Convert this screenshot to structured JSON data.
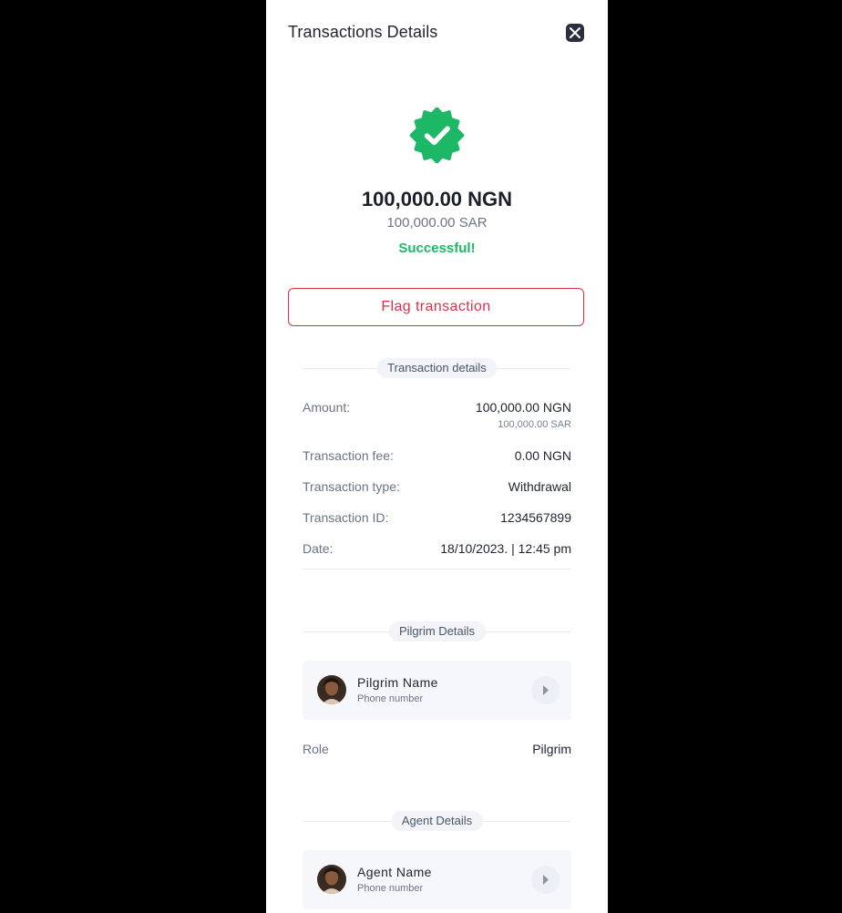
{
  "header": {
    "title": "Transactions Details"
  },
  "summary": {
    "amount": "100,000.00 NGN",
    "amount_alt": "100,000.00 SAR",
    "status": "Successful!"
  },
  "actions": {
    "flag_label": "Flag transaction"
  },
  "transaction_details": {
    "heading": "Transaction details",
    "rows": [
      {
        "label": "Amount:",
        "value": "100,000.00 NGN",
        "subvalue": "100,000.00 SAR"
      },
      {
        "label": "Transaction fee:",
        "value": "0.00 NGN"
      },
      {
        "label": "Transaction type:",
        "value": "Withdrawal"
      },
      {
        "label": "Transaction ID:",
        "value": "1234567899"
      },
      {
        "label": "Date:",
        "value": "18/10/2023. | 12:45 pm"
      }
    ]
  },
  "pilgrim_details": {
    "heading": "Pilgrim Details",
    "name": "Pilgrim Name",
    "phone": "Phone number",
    "role_label": "Role",
    "role_value": "Pilgrim"
  },
  "agent_details": {
    "heading": "Agent Details",
    "name": "Agent Name",
    "phone": "Phone number"
  },
  "colors": {
    "success": "#1db866",
    "danger": "#d6334a",
    "text": "#1f2430",
    "muted": "#6b7486",
    "backdrop": "#000000"
  },
  "icons": {
    "close": "close-icon",
    "badge": "verified-check-badge-icon",
    "chevron": "chevron-right-icon"
  }
}
